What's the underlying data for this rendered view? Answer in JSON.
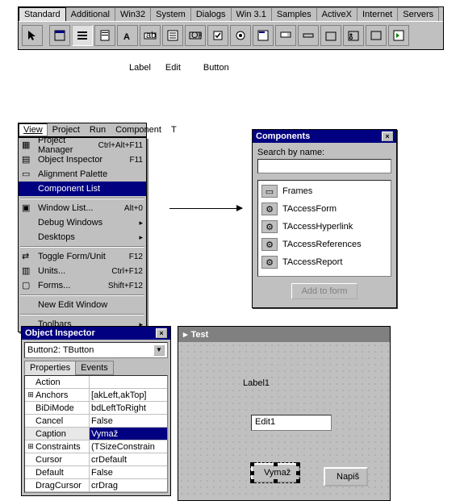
{
  "palette": {
    "tabs": [
      "Standard",
      "Additional",
      "Win32",
      "System",
      "Dialogs",
      "Win 3.1",
      "Samples",
      "ActiveX",
      "Internet",
      "Servers"
    ],
    "active_tab": 0,
    "labels": {
      "label": "Label",
      "edit": "Edit",
      "button": "Button"
    }
  },
  "menubar": {
    "items": [
      "View",
      "Project",
      "Run",
      "Component",
      "T"
    ],
    "active": 0
  },
  "view_menu": {
    "items": [
      {
        "label": "Project Manager",
        "shortcut": "Ctrl+Alt+F11",
        "icon": "project-icon"
      },
      {
        "label": "Object Inspector",
        "shortcut": "F11",
        "icon": "inspector-icon"
      },
      {
        "label": "Alignment Palette",
        "shortcut": "",
        "icon": "align-icon"
      },
      {
        "label": "Component List",
        "shortcut": "",
        "icon": "",
        "hl": true
      },
      {
        "label": "Window List...",
        "shortcut": "Alt+0",
        "icon": "window-icon",
        "sep_before": true
      },
      {
        "label": "Debug Windows",
        "shortcut": "",
        "sub": true
      },
      {
        "label": "Desktops",
        "shortcut": "",
        "sub": true
      },
      {
        "label": "Toggle Form/Unit",
        "shortcut": "F12",
        "icon": "toggle-icon",
        "sep_before": true
      },
      {
        "label": "Units...",
        "shortcut": "Ctrl+F12",
        "icon": "units-icon"
      },
      {
        "label": "Forms...",
        "shortcut": "Shift+F12",
        "icon": "forms-icon"
      },
      {
        "label": "New Edit Window",
        "shortcut": "",
        "sep_before": true
      },
      {
        "label": "Toolbars",
        "shortcut": "",
        "sub": true,
        "sep_before": true
      }
    ]
  },
  "components_dialog": {
    "title": "Components",
    "search_label": "Search by name:",
    "search_value": "",
    "items": [
      "Frames",
      "TAccessForm",
      "TAccessHyperlink",
      "TAccessReferences",
      "TAccessReport"
    ],
    "add_label": "Add to form"
  },
  "inspector": {
    "title": "Object Inspector",
    "selector": "Button2: TButton",
    "tabs": [
      "Properties",
      "Events"
    ],
    "active_tab": 0,
    "props": [
      {
        "name": "Action",
        "value": "",
        "expand": ""
      },
      {
        "name": "Anchors",
        "value": "[akLeft,akTop]",
        "expand": "+"
      },
      {
        "name": "BiDiMode",
        "value": "bdLeftToRight",
        "expand": ""
      },
      {
        "name": "Cancel",
        "value": "False",
        "expand": ""
      },
      {
        "name": "Caption",
        "value": "Vymaž",
        "expand": "",
        "sel": true
      },
      {
        "name": "Constraints",
        "value": "(TSizeConstrain",
        "expand": "+"
      },
      {
        "name": "Cursor",
        "value": "crDefault",
        "expand": ""
      },
      {
        "name": "Default",
        "value": "False",
        "expand": ""
      },
      {
        "name": "DragCursor",
        "value": "crDrag",
        "expand": ""
      }
    ]
  },
  "form": {
    "title": "Test",
    "label1": "Label1",
    "edit1": "Edit1",
    "button2": "Vymaž",
    "button3": "Napiš"
  }
}
